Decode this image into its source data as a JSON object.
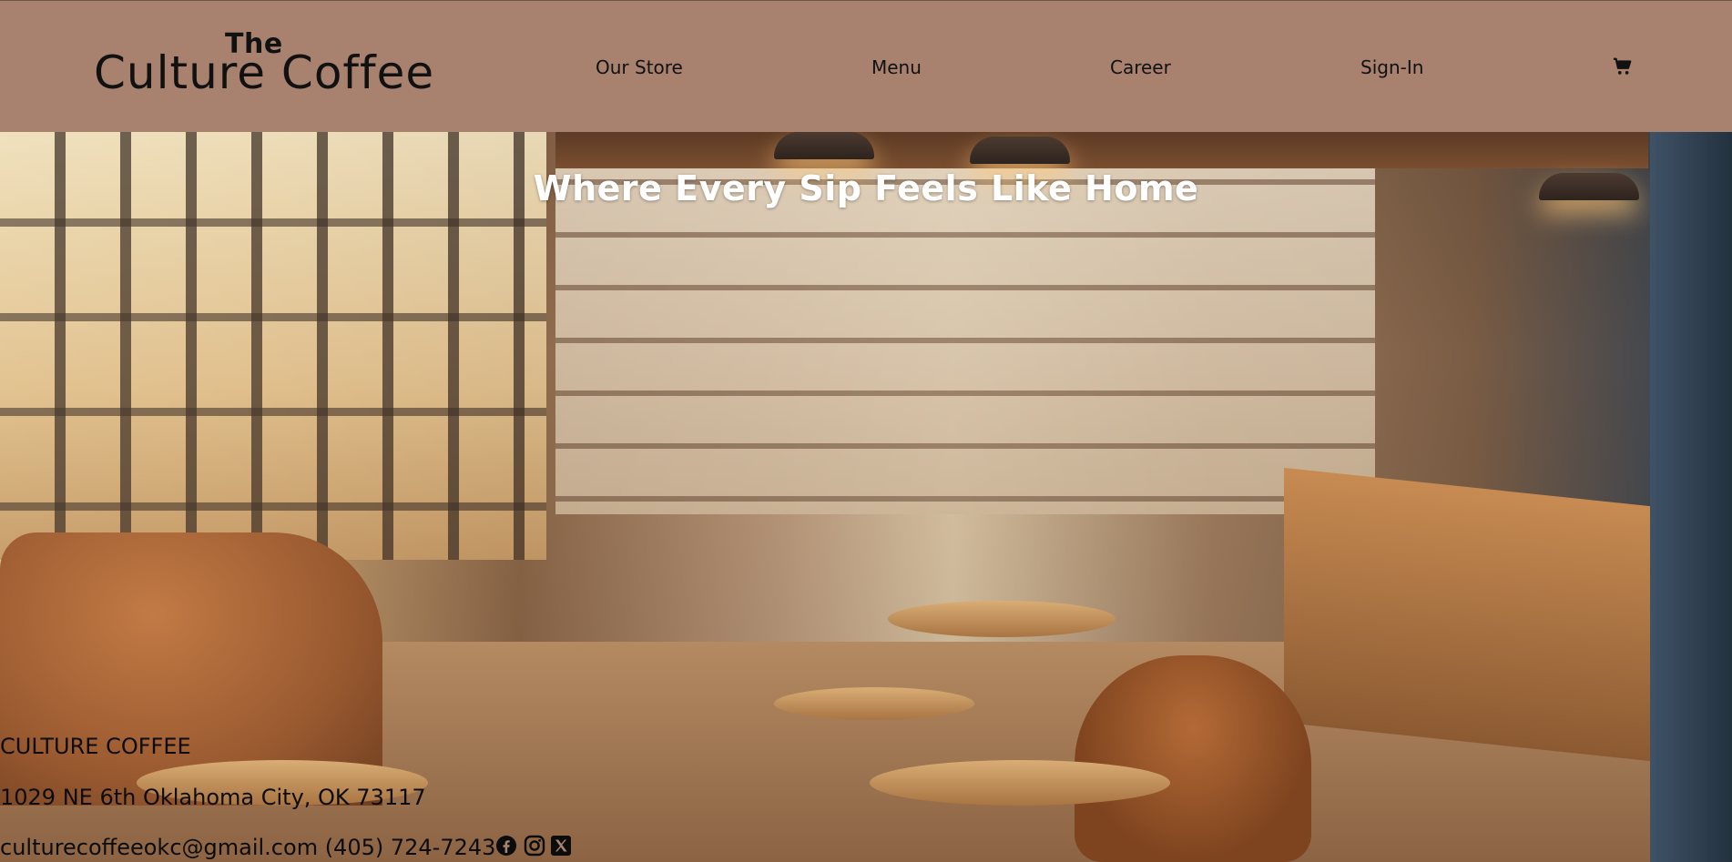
{
  "header": {
    "logo_top": "The",
    "logo_name": "Culture Coffee",
    "nav": [
      {
        "label": "Our Store"
      },
      {
        "label": "Menu"
      },
      {
        "label": "Career"
      },
      {
        "label": "Sign-In"
      }
    ],
    "cart_icon": "shopping-cart-icon",
    "background": "#a8826f"
  },
  "hero": {
    "headline": "Where Every Sip Feels Like Home"
  },
  "footer": {
    "company": "CULTURE COFFEE",
    "address": "1029 NE 6th Oklahoma City, OK 73117",
    "contact": "culturecoffeeokc@gmail.com (405) 724-7243",
    "social_icons": [
      "facebook-icon",
      "instagram-icon",
      "x-icon"
    ]
  }
}
